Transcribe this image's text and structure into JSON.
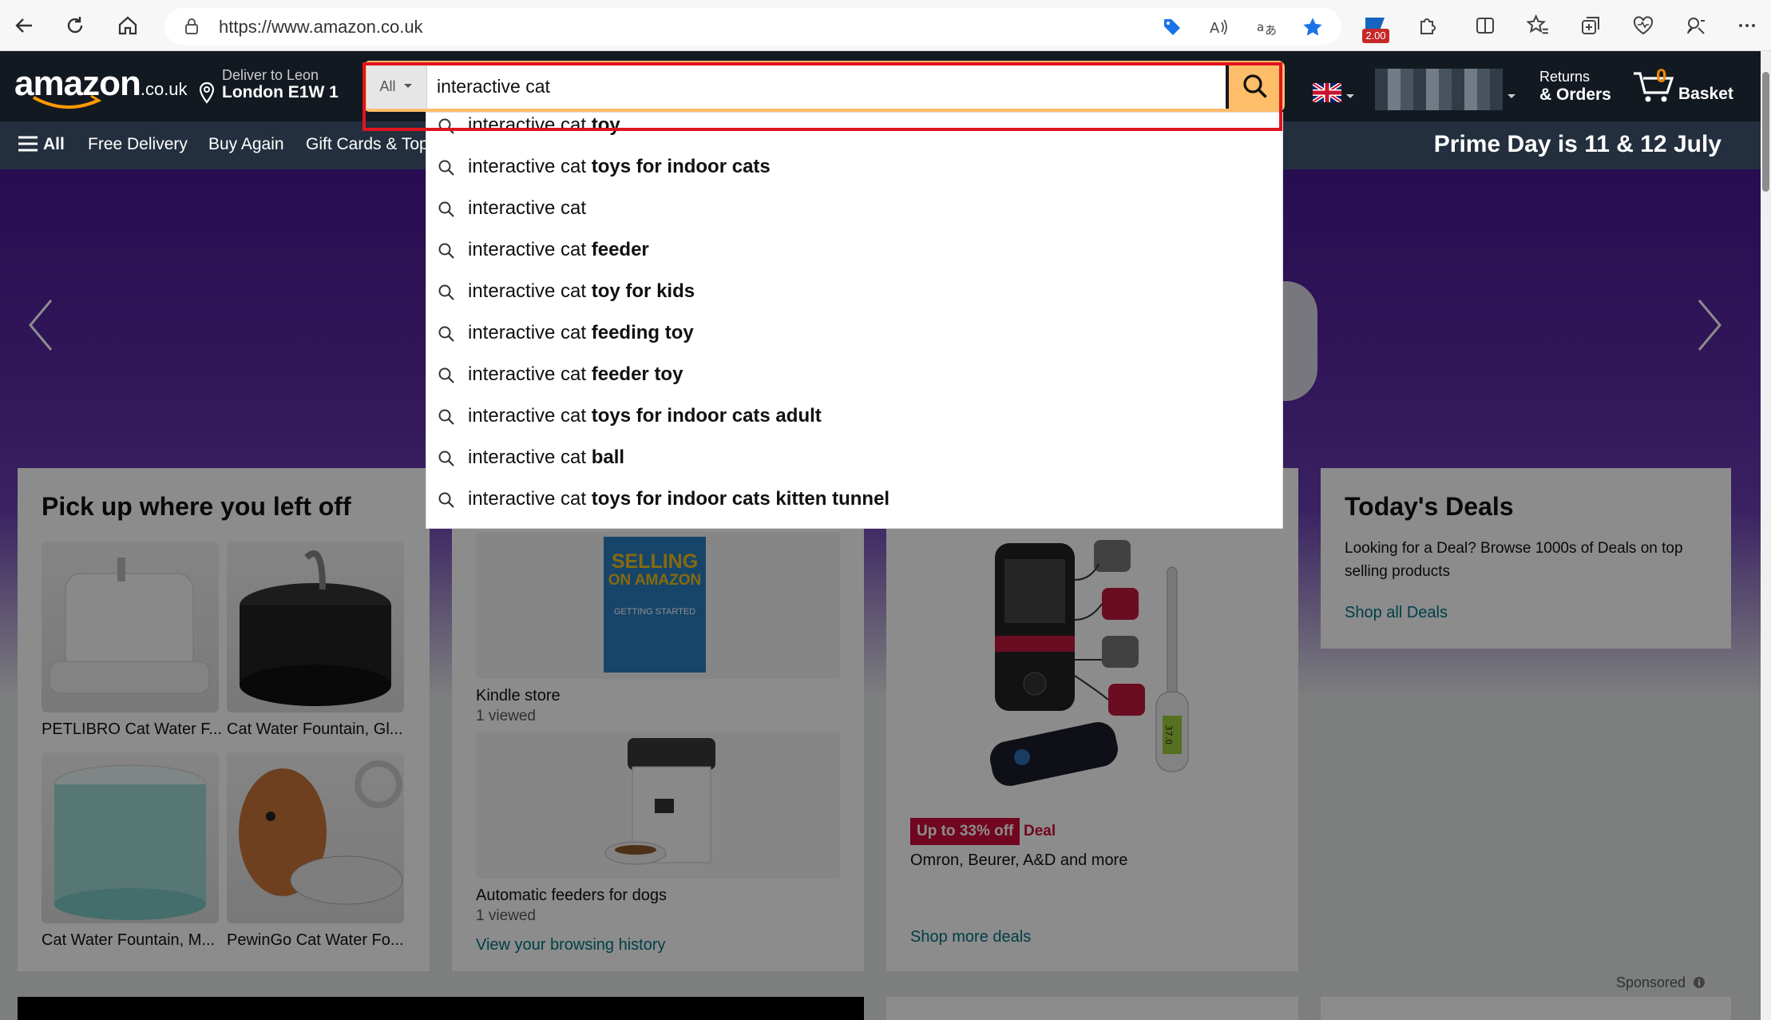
{
  "browser": {
    "url": "https://www.amazon.co.uk",
    "extension_badge": "2.00"
  },
  "header": {
    "logo_text": "amazon",
    "logo_tld": ".co.uk",
    "deliver_line1": "Deliver to Leon",
    "deliver_line2": "London E1W 1",
    "search_category": "All",
    "search_value": "interactive cat",
    "returns_line1": "Returns",
    "returns_line2": "& Orders",
    "basket_count": "0",
    "basket_label": "Basket"
  },
  "nav": {
    "all": "All",
    "items": [
      "Free Delivery",
      "Buy Again",
      "Gift Cards & Top"
    ],
    "promo": "Prime Day is 11 & 12 July"
  },
  "suggestions": [
    {
      "prefix": "interactive cat ",
      "bold": "toy"
    },
    {
      "prefix": "interactive cat ",
      "bold": "toys for indoor cats"
    },
    {
      "prefix": "interactive cat",
      "bold": ""
    },
    {
      "prefix": "interactive cat ",
      "bold": "feeder"
    },
    {
      "prefix": "interactive cat ",
      "bold": "toy for kids"
    },
    {
      "prefix": "interactive cat ",
      "bold": "feeding toy"
    },
    {
      "prefix": "interactive cat ",
      "bold": "feeder toy"
    },
    {
      "prefix": "interactive cat ",
      "bold": "toys for indoor cats adult"
    },
    {
      "prefix": "interactive cat ",
      "bold": "ball"
    },
    {
      "prefix": "interactive cat ",
      "bold": "toys for indoor cats kitten tunnel"
    }
  ],
  "card_pickup": {
    "title": "Pick up where you left off",
    "items": [
      "PETLIBRO Cat Water F...",
      "Cat Water Fountain, Gl...",
      "Cat Water Fountain, M...",
      "PewinGo Cat Water Fo..."
    ]
  },
  "card_history": {
    "book_line1": "SELLING",
    "book_line2": "ON AMAZON",
    "book_line3": "GETTING STARTED",
    "item1_title": "Kindle store",
    "item1_sub": "1 viewed",
    "item2_title": "Automatic feeders for dogs",
    "item2_sub": "1 viewed",
    "link": "View your browsing history"
  },
  "card_health": {
    "badge": "Up to 33% off",
    "deal": "Deal",
    "desc": "Omron, Beurer, A&D and more",
    "link": "Shop more deals",
    "thermo_display": "37.0"
  },
  "card_deals": {
    "title": "Today's Deals",
    "desc": "Looking for a Deal? Browse 1000s of Deals on top selling products",
    "link": "Shop all Deals"
  },
  "sponsored": "Sponsored",
  "colors": {
    "amazon_dark": "#131921",
    "amazon_nav": "#232f3e",
    "search_orange": "#febd69",
    "highlight_red": "#e0141e",
    "link_teal": "#007185",
    "deal_red": "#cc0c39"
  }
}
